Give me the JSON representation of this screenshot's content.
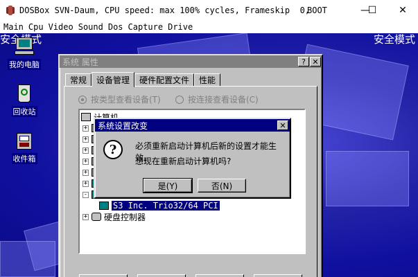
{
  "host": {
    "title": "DOSBox SVN-Daum, CPU speed: max 100% cycles, Frameskip  0,",
    "title_boot": "BOOT",
    "controls": {
      "minimize": "—",
      "maximize": "☐",
      "close": "✕"
    },
    "menu": [
      "Main",
      "Cpu",
      "Video",
      "Sound",
      "Dos",
      "Capture",
      "Drive"
    ]
  },
  "desktop": {
    "safe_mode_left": "安全模式",
    "safe_mode_right": "安全模式",
    "icons": [
      {
        "label": "我的电脑",
        "icon": "my-computer-icon"
      },
      {
        "label": "回收站",
        "icon": "recycle-bin-icon"
      },
      {
        "label": "收件箱",
        "icon": "inbox-icon"
      }
    ]
  },
  "system_properties": {
    "title": "系统 属性",
    "help_btn": "?",
    "close_btn": "✕",
    "tabs": [
      "常规",
      "设备管理",
      "硬件配置文件",
      "性能"
    ],
    "active_tab": 1,
    "view_by_type": "按类型查看设备(T)",
    "view_by_connection": "按连接查看设备(C)",
    "tree": {
      "root": "计算机",
      "selected_device": "S3 Inc. Trio32/64 PCI",
      "hdd_controller": "硬盘控制器"
    }
  },
  "restart_dialog": {
    "title": "系统设置改变",
    "close_btn": "✕",
    "line1": "必须重新启动计算机后新的设置才能生效。",
    "line2": "想现在重新启动计算机吗?",
    "yes": "是(Y)",
    "no": "否(N)"
  }
}
